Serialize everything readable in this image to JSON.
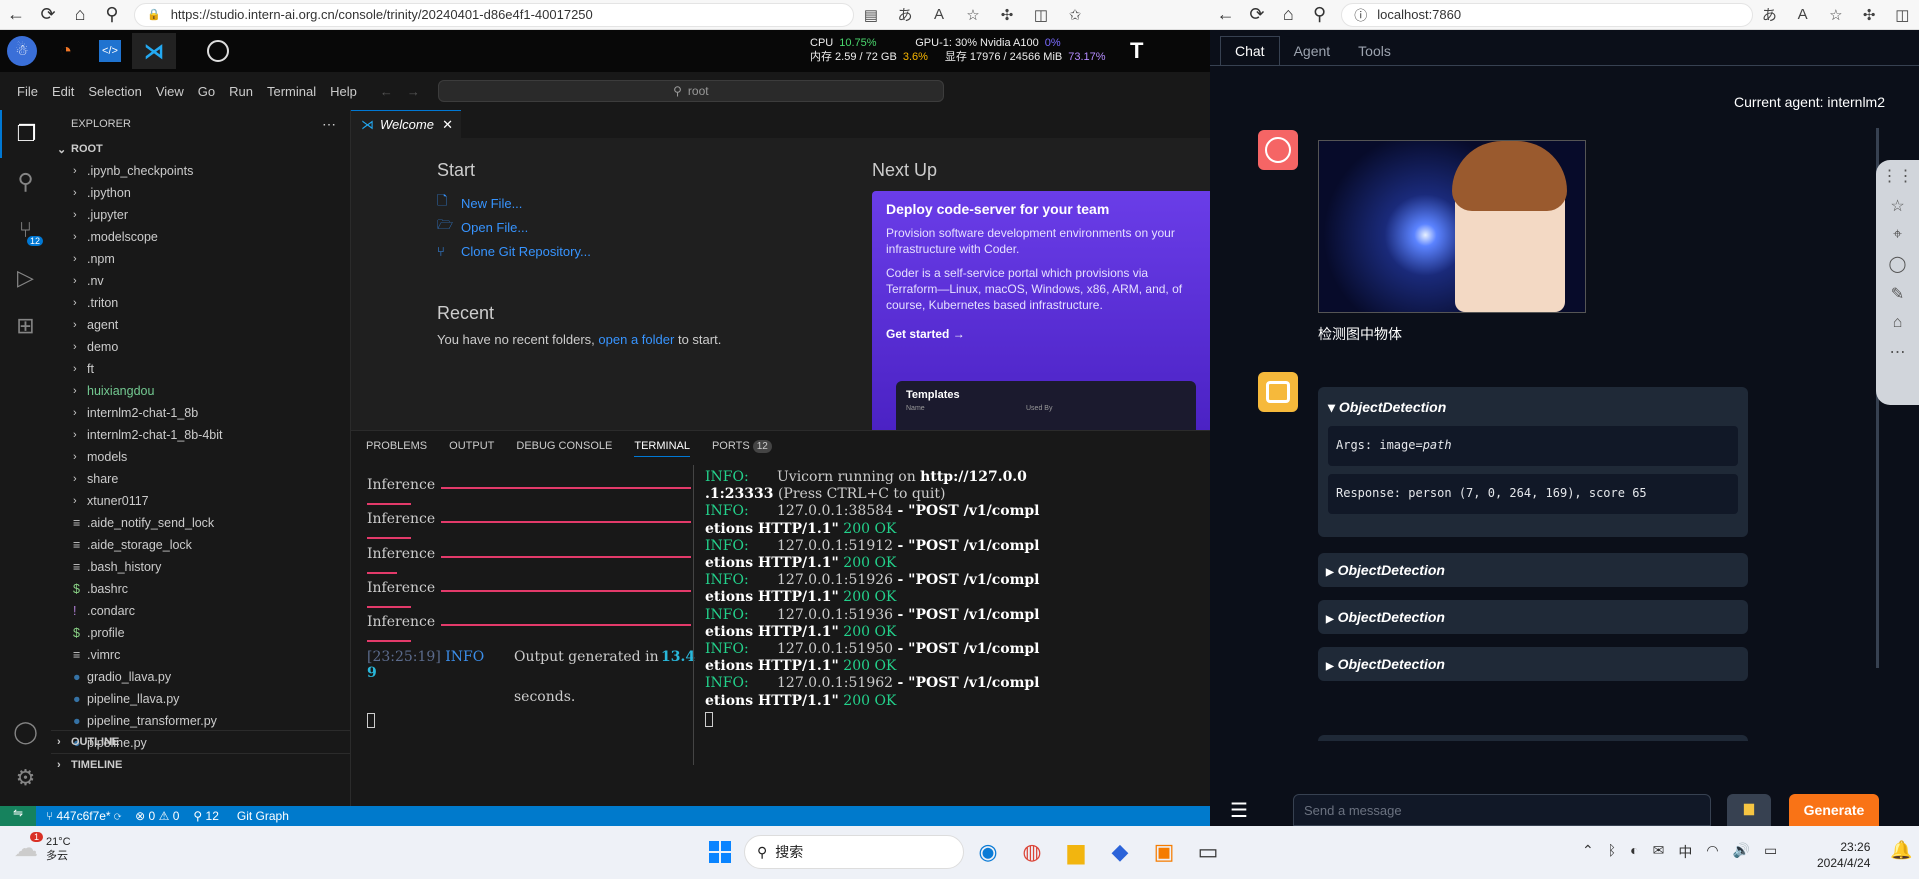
{
  "left_browser": {
    "url": "https://studio.intern-ai.org.cn/console/trinity/20240401-d86e4f1-40017250"
  },
  "studio": {
    "cpu_label": "CPU",
    "cpu_val": "10.75%",
    "gpu_label": "GPU-1: 30% Nvidia A100",
    "gpu_val": "0%",
    "mem_label": "内存 2.59 / 72 GB",
    "mem_val": "3.6%",
    "vram_label": "显存 17976 / 24566 MiB",
    "vram_val": "73.17%"
  },
  "menu": [
    "File",
    "Edit",
    "Selection",
    "View",
    "Go",
    "Run",
    "Terminal",
    "Help"
  ],
  "search_text": "root",
  "explorer": {
    "title": "EXPLORER",
    "root": "ROOT",
    "folders": [
      ".ipynb_checkpoints",
      ".ipython",
      ".jupyter",
      ".modelscope",
      ".npm",
      ".nv",
      ".triton",
      "agent",
      "demo",
      "ft",
      "huixiangdou",
      "internlm2-chat-1_8b",
      "internlm2-chat-1_8b-4bit",
      "models",
      "share",
      "xtuner0117"
    ],
    "files": [
      ".aide_notify_send_lock",
      ".aide_storage_lock",
      ".bash_history",
      ".bashrc",
      ".condarc",
      ".profile",
      ".vimrc",
      "gradio_llava.py",
      "pipeline_llava.py",
      "pipeline_transformer.py",
      "pipeline.py"
    ],
    "outline": "OUTLINE",
    "timeline": "TIMELINE"
  },
  "scm_badge": "12",
  "tab": {
    "label": "Welcome"
  },
  "welcome": {
    "start": "Start",
    "new_file": "New File...",
    "open_file": "Open File...",
    "clone": "Clone Git Repository...",
    "recent": "Recent",
    "recent_text": "You have no recent folders,",
    "open_folder": "open a folder",
    "recent_tail": "to start.",
    "next_up": "Next Up",
    "card_title": "Deploy code-server for your team",
    "card_p1": "Provision software development environments on your infrastructure with Coder.",
    "card_p2": "Coder is a self-service portal which provisions via Terraform—Linux, macOS, Windows, x86, ARM, and, of course, Kubernetes based infrastructure.",
    "card_cta": "Get started",
    "templates": "Templates",
    "tpl_name": "Name",
    "tpl_used": "Used By"
  },
  "panel_tabs": [
    "PROBLEMS",
    "OUTPUT",
    "DEBUG CONSOLE",
    "TERMINAL",
    "PORTS"
  ],
  "ports_badge": "12",
  "term_left": {
    "inference": "Inference",
    "ts": "[23:25:19]",
    "lvl": "INFO",
    "msg": "Output generated in",
    "num": "13.4",
    "num2": "9",
    "tail": "seconds."
  },
  "term_right": {
    "l1a": "INFO:",
    "l1b": "Uvicorn running on",
    "l1c": "http://127.0.0",
    "l2a": ".1:23333",
    "l2b": "(Press CTRL+C to quit)",
    "reqs": [
      {
        "ip": "127.0.0.1:38584"
      },
      {
        "ip": "127.0.0.1:51912"
      },
      {
        "ip": "127.0.0.1:51926"
      },
      {
        "ip": "127.0.0.1:51936"
      },
      {
        "ip": "127.0.0.1:51950"
      },
      {
        "ip": "127.0.0.1:51962"
      }
    ],
    "post": "- \"POST /v1/compl",
    "etions": "etions HTTP/1.1\"",
    "ok": "200 OK"
  },
  "status": {
    "branch": "447c6f7e*",
    "errors": "0",
    "warnings": "0",
    "ports": "12",
    "graph": "Git Graph"
  },
  "right_browser": {
    "url": "localhost:7860",
    "tabs": [
      "Chat",
      "Agent",
      "Tools"
    ],
    "current_agent": "Current agent: internlm2",
    "user_msg": "检测图中物体",
    "tool": "ObjectDetection",
    "args_label": "Args: image=",
    "args_val": "path",
    "response": "Response: person (7, 0, 264, 169), score 65",
    "placeholder": "Send a message",
    "generate": "Generate"
  },
  "taskbar": {
    "temp": "21°C",
    "weather": "多云",
    "search": "搜索",
    "lang": "中",
    "time": "23:26",
    "date": "2024/4/24",
    "weather_badge": "1"
  }
}
